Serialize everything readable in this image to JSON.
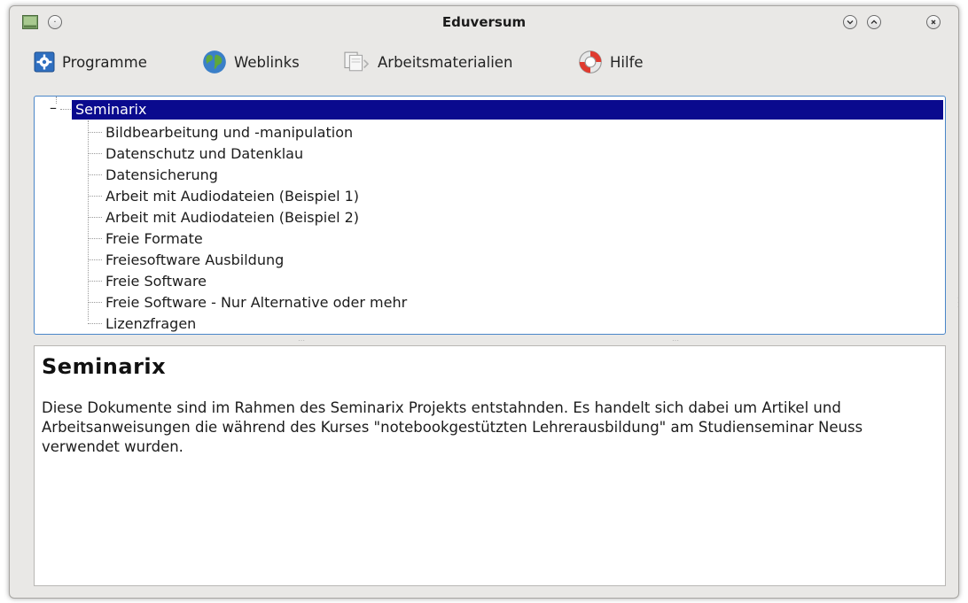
{
  "window": {
    "title": "Eduversum"
  },
  "titlebar_buttons": {
    "menu_icon": "circle-dot-icon",
    "minimize_icon": "chevron-down-icon",
    "maximize_icon": "chevron-up-icon",
    "close_icon": "close-icon"
  },
  "menubar": {
    "items": [
      {
        "label": "Programme",
        "icon": "gear-settings-icon"
      },
      {
        "label": "Weblinks",
        "icon": "globe-icon"
      },
      {
        "label": "Arbeitsmaterialien",
        "icon": "documents-icon"
      },
      {
        "label": "Hilfe",
        "icon": "lifebuoy-icon"
      }
    ]
  },
  "tree": {
    "root": {
      "label": "Seminarix",
      "expander": "–"
    },
    "children": [
      "Bildbearbeitung und -manipulation",
      "Datenschutz und Datenklau",
      "Datensicherung",
      "Arbeit mit Audiodateien (Beispiel 1)",
      "Arbeit mit Audiodateien (Beispiel 2)",
      "Freie Formate",
      "Freiesoftware Ausbildung",
      "Freie Software",
      "Freie Software - Nur Alternative oder mehr",
      "Lizenzfragen"
    ]
  },
  "document": {
    "heading": "Seminarix",
    "body": "Diese Dokumente sind im Rahmen des Seminarix Projekts entstahnden. Es handelt sich dabei um Artikel und Arbeitsanweisungen die während des Kurses \"notebookgestützten Lehrerausbildung\" am Studienseminar Neuss verwendet wurden."
  },
  "colors": {
    "selection": "#0a0a8e",
    "focus_border": "#4a86c8",
    "window_bg": "#e9e8e6"
  }
}
